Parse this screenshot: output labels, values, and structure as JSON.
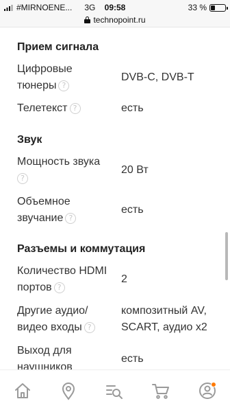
{
  "status_bar": {
    "carrier": "#MIRNOENE...",
    "network": "3G",
    "time": "09:58",
    "battery": "33 %",
    "battery_level_percent": 33
  },
  "browser": {
    "url": "technopoint.ru"
  },
  "sections": {
    "signal": {
      "title": "Прием сигнала",
      "rows": [
        {
          "label_line1": "Цифровые",
          "label_line2": "тюнеры",
          "value": "DVB-C, DVB-T"
        },
        {
          "label_line1": "Телетекст",
          "value": "есть"
        }
      ]
    },
    "sound": {
      "title": "Звук",
      "rows": [
        {
          "label_line1": "Мощность звука",
          "value": "20 Вт"
        },
        {
          "label_line1": "Объемное",
          "label_line2": "звучание",
          "value": "есть"
        }
      ]
    },
    "connectors": {
      "title": "Разъемы и коммутация",
      "rows": [
        {
          "label_line1": "Количество HDMI",
          "label_line2": "портов",
          "value": "2"
        },
        {
          "label_line1": "Другие аудио/",
          "label_line2": "видео входы",
          "value_line1": "композитный AV,",
          "value_line2": "SCART, аудио x2"
        },
        {
          "label_line1": "Выход для",
          "label_line2": "наушников",
          "value": "есть"
        }
      ]
    }
  },
  "help_glyph": "?",
  "nav": {
    "items": [
      "home-icon",
      "location-pin-icon",
      "catalog-search-icon",
      "cart-icon",
      "profile-icon"
    ],
    "accent_color": "#ff7a00",
    "icon_color": "#9a9a9a"
  }
}
